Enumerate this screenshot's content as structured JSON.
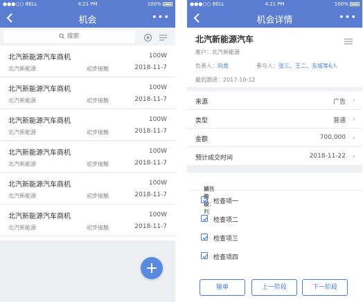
{
  "status": {
    "carrier": "●●●○○ BELL",
    "time": "4:21 PM",
    "battery": "100%"
  },
  "list_screen": {
    "title": "机会",
    "more": "•••",
    "search": {
      "placeholder": "搜索"
    },
    "items": [
      {
        "name": "北汽新能源汽车商机",
        "amount": "100W",
        "company": "北汽新能源",
        "stage": "初步接触",
        "date": "2018-11-7"
      },
      {
        "name": "北汽新能源汽车商机",
        "amount": "100W",
        "company": "北汽新能源",
        "stage": "初步接触",
        "date": "2018-11-7"
      },
      {
        "name": "北汽新能源汽车商机",
        "amount": "100W",
        "company": "北汽新能源",
        "stage": "初步接触",
        "date": "2018-11-7"
      },
      {
        "name": "北汽新能源汽车商机",
        "amount": "100W",
        "company": "北汽新能源",
        "stage": "初步接触",
        "date": "2018-11-7"
      },
      {
        "name": "北汽新能源汽车商机",
        "amount": "100W",
        "company": "北汽新能源",
        "stage": "初步接触",
        "date": "2018-11-7"
      },
      {
        "name": "北汽新能源汽车商机",
        "amount": "100W",
        "company": "北汽新能源",
        "stage": "初步接触",
        "date": "2018-11-7"
      }
    ]
  },
  "detail_screen": {
    "title": "机会详情",
    "more": "•••",
    "heading": "北汽新能源汽车",
    "customer_label": "客户：",
    "customer": "北汽新能源",
    "owner_label": "负责人：",
    "owner": "向南",
    "participants_label": "参与人：",
    "participants": "张三、王二、东城等6人",
    "last_followup_label": "最后跟进：",
    "last_followup": "2017-10-12",
    "fields": [
      {
        "label": "来源",
        "value": "广告"
      },
      {
        "label": "类型",
        "value": "普通"
      },
      {
        "label": "金额",
        "value": "700,000"
      },
      {
        "label": "预计成交时间",
        "value": "2018-11-22"
      }
    ],
    "stage_label": "销售阶段：",
    "stage": "商务谈判",
    "checklist": [
      "检查项一",
      "检查项二",
      "检查项三",
      "检查项四"
    ],
    "buttons": {
      "lose": "输单",
      "prev": "上一阶段",
      "next": "下一阶段"
    }
  },
  "colors": {
    "brand": "#5a7dd1",
    "accent": "#4a7fd9",
    "background": "#eef0f4"
  }
}
